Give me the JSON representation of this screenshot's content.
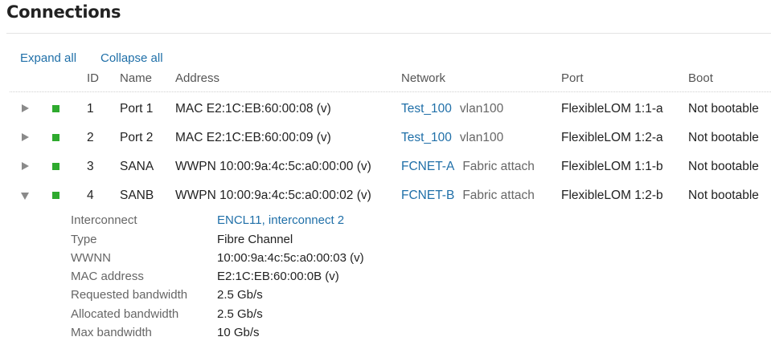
{
  "title": "Connections",
  "actions": {
    "expand_all": "Expand all",
    "collapse_all": "Collapse all"
  },
  "columns": {
    "id": "ID",
    "name": "Name",
    "address": "Address",
    "network": "Network",
    "port": "Port",
    "boot": "Boot"
  },
  "rows": [
    {
      "expanded": false,
      "status": "ok",
      "id": "1",
      "name": "Port 1",
      "address": "MAC E2:1C:EB:60:00:08 (v)",
      "network": "Test_100",
      "network_sub": "vlan100",
      "port": "FlexibleLOM 1:1-a",
      "boot": "Not bootable"
    },
    {
      "expanded": false,
      "status": "ok",
      "id": "2",
      "name": "Port 2",
      "address": "MAC E2:1C:EB:60:00:09 (v)",
      "network": "Test_100",
      "network_sub": "vlan100",
      "port": "FlexibleLOM 1:2-a",
      "boot": "Not bootable"
    },
    {
      "expanded": false,
      "status": "ok",
      "id": "3",
      "name": "SANA",
      "address": "WWPN 10:00:9a:4c:5c:a0:00:00 (v)",
      "network": "FCNET-A",
      "network_sub": "Fabric attach",
      "port": "FlexibleLOM 1:1-b",
      "boot": "Not bootable"
    },
    {
      "expanded": true,
      "status": "ok",
      "id": "4",
      "name": "SANB",
      "address": "WWPN 10:00:9a:4c:5c:a0:00:02 (v)",
      "network": "FCNET-B",
      "network_sub": "Fabric attach",
      "port": "FlexibleLOM 1:2-b",
      "boot": "Not bootable"
    }
  ],
  "details": [
    {
      "label": "Interconnect",
      "value": "ENCL11, interconnect 2",
      "link": true
    },
    {
      "label": "Type",
      "value": "Fibre Channel",
      "link": false
    },
    {
      "label": "WWNN",
      "value": "10:00:9a:4c:5c:a0:00:03 (v)",
      "link": false
    },
    {
      "label": "MAC address",
      "value": "E2:1C:EB:60:00:0B (v)",
      "link": false
    },
    {
      "label": "Requested bandwidth",
      "value": "2.5 Gb/s",
      "link": false
    },
    {
      "label": "Allocated bandwidth",
      "value": "2.5 Gb/s",
      "link": false
    },
    {
      "label": "Max bandwidth",
      "value": "10 Gb/s",
      "link": false
    }
  ],
  "colors": {
    "link": "#1f6fa8",
    "status_ok": "#2eaa2e",
    "toggle": "#8a8a8a"
  }
}
